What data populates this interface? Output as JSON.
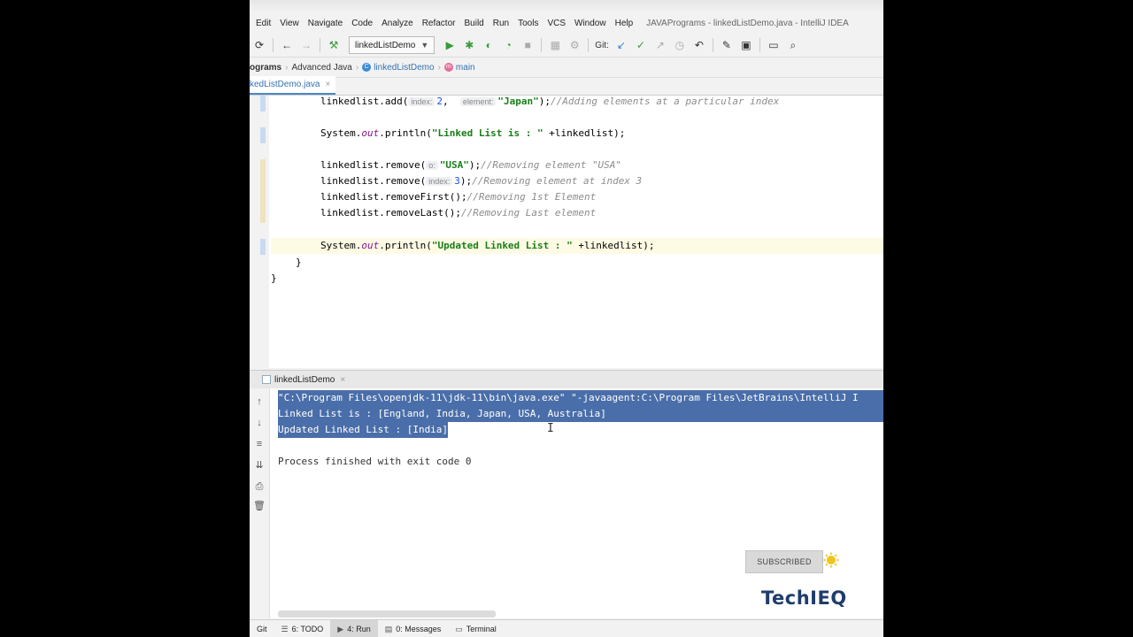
{
  "menu": {
    "items": [
      "Edit",
      "View",
      "Navigate",
      "Code",
      "Analyze",
      "Refactor",
      "Build",
      "Run",
      "Tools",
      "VCS",
      "Window",
      "Help"
    ],
    "window_title": "JAVAPrograms - linkedListDemo.java - IntelliJ IDEA"
  },
  "toolbar": {
    "run_config": "linkedListDemo",
    "git_label": "Git:"
  },
  "breadcrumb": {
    "project": "ograms",
    "folder": "Advanced Java",
    "class": "linkedListDemo",
    "method": "main"
  },
  "editor": {
    "tab": "kedListDemo.java",
    "code": {
      "l1_pre": "linkedlist.add(",
      "l1_hint1": "index:",
      "l1_num": "2",
      "l1_comma": ",",
      "l1_hint2": "element:",
      "l1_str": "\"Japan\"",
      "l1_close": ");",
      "l1_comment": "//Adding elements at a particular index",
      "l2_pre": "System.",
      "l2_field": "out",
      "l2_mid": ".println(",
      "l2_str": "\"Linked List is : \"",
      "l2_post": " +linkedlist);",
      "l3_pre": "linkedlist.remove(",
      "l3_hint": "o:",
      "l3_str": "\"USA\"",
      "l3_close": ");",
      "l3_comment": "//Removing element \"USA\"",
      "l4_pre": "linkedlist.remove(",
      "l4_hint": "index:",
      "l4_num": "3",
      "l4_close": ");",
      "l4_comment": "//Removing element at index 3",
      "l5_pre": "linkedlist.removeFirst();",
      "l5_comment": "//Removing 1st Element",
      "l6_pre": "linkedlist.removeLast();",
      "l6_comment": "//Removing Last element",
      "l7_pre": "System.",
      "l7_field": "out",
      "l7_mid": ".println(",
      "l7_str": "\"Updated Linked List : \"",
      "l7_post": " +linkedlist);",
      "l8": "}",
      "l9": "}"
    }
  },
  "run": {
    "tab": "linkedListDemo",
    "lines": {
      "cmd": "\"C:\\Program Files\\openjdk-11\\jdk-11\\bin\\java.exe\" \"-javaagent:C:\\Program Files\\JetBrains\\IntelliJ I",
      "out1": "Linked List is : [England, India, Japan, USA, Australia]",
      "out2": "Updated Linked List : [India]",
      "exit": "Process finished with exit code 0"
    }
  },
  "bottombar": {
    "git": "Git",
    "todo": "6: TODO",
    "run": "4: Run",
    "messages": "0: Messages",
    "terminal": "Terminal"
  },
  "overlay": {
    "subscribed": "SUBSCRIBED",
    "brand": "TechIEQ"
  },
  "colors": {
    "selection": "#4a6ea9",
    "string": "#177f17",
    "comment": "#8c8c8c",
    "brand": "#1e3d6b"
  }
}
